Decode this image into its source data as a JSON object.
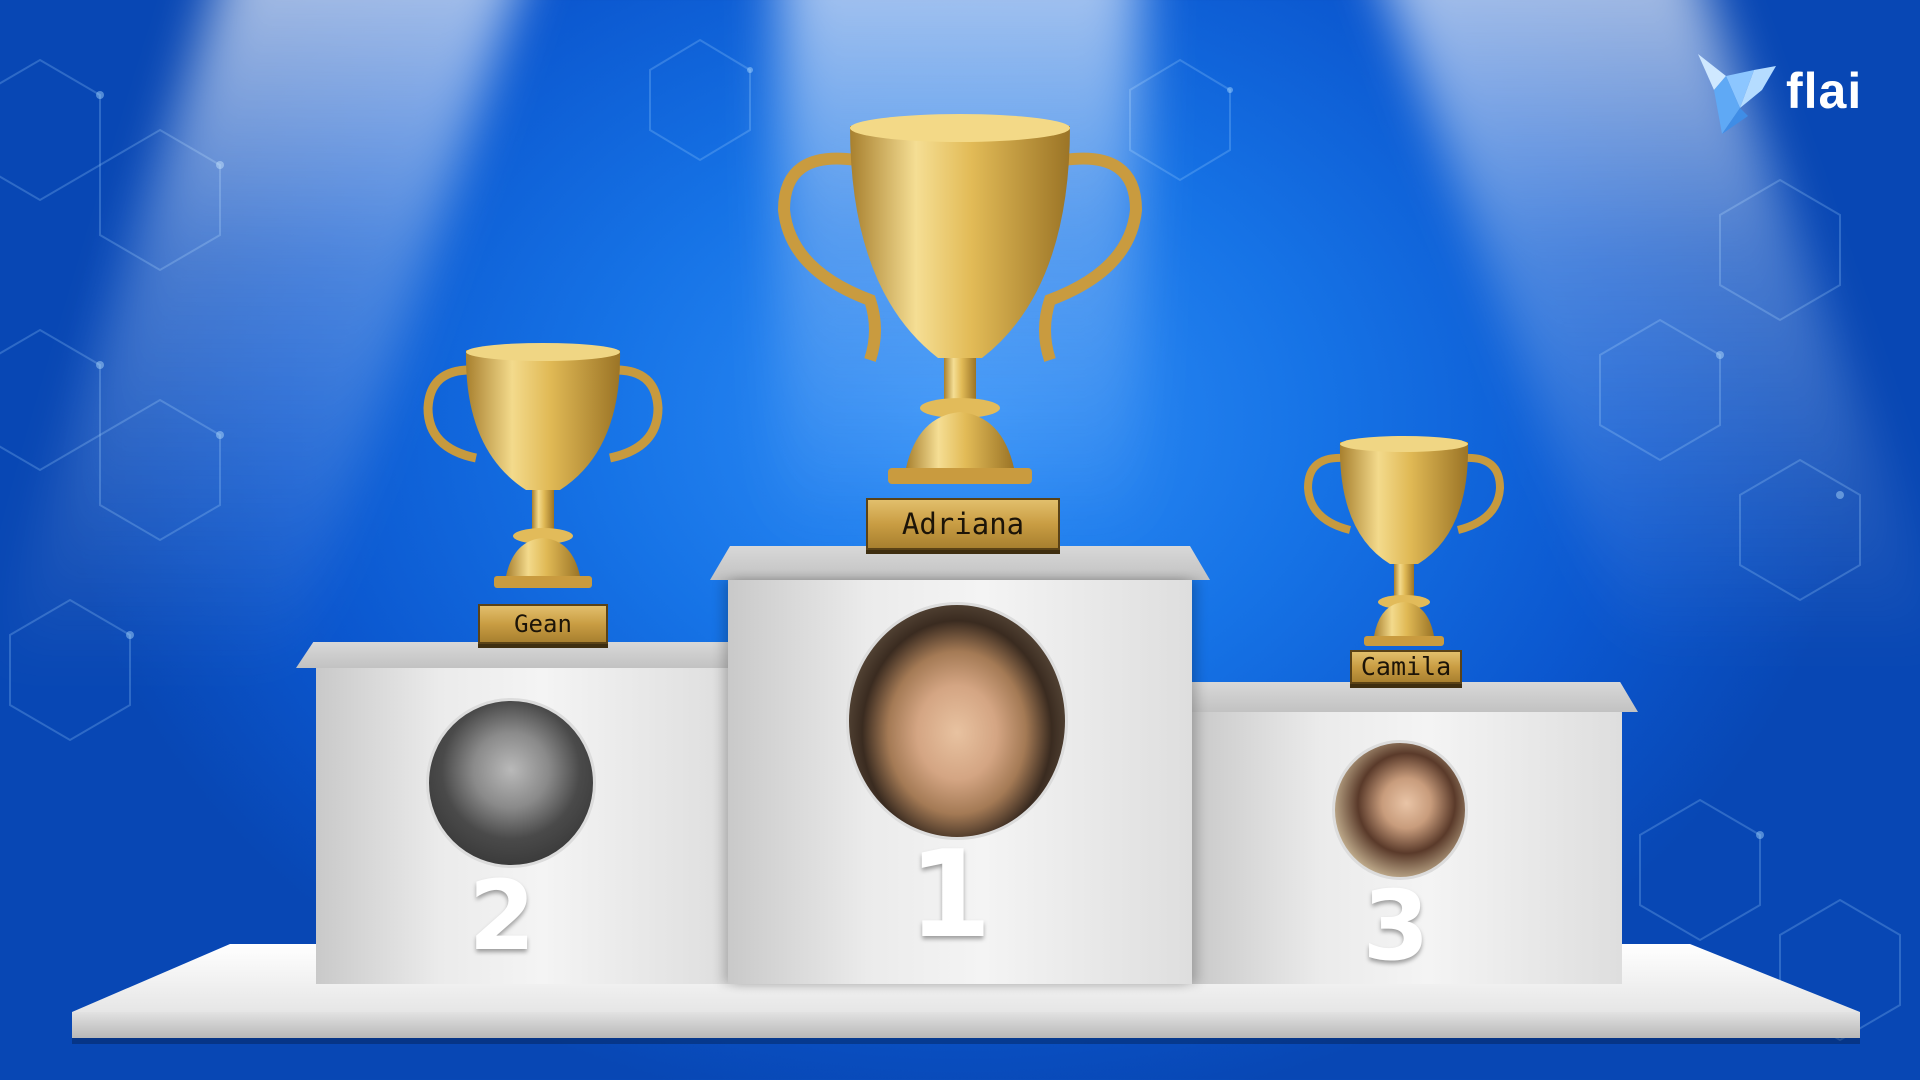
{
  "brand": {
    "name": "flai",
    "logo_icon": "origami-bird-icon"
  },
  "podium": [
    {
      "place_label": "2",
      "name": "Gean",
      "avatar": "avatar-gean"
    },
    {
      "place_label": "1",
      "name": "Adriana",
      "avatar": "avatar-adriana"
    },
    {
      "place_label": "3",
      "name": "Camila",
      "avatar": "avatar-camila"
    }
  ],
  "colors": {
    "background": "#1673e6",
    "trophy_gold": "#d9b24a",
    "podium": "#ececec"
  }
}
